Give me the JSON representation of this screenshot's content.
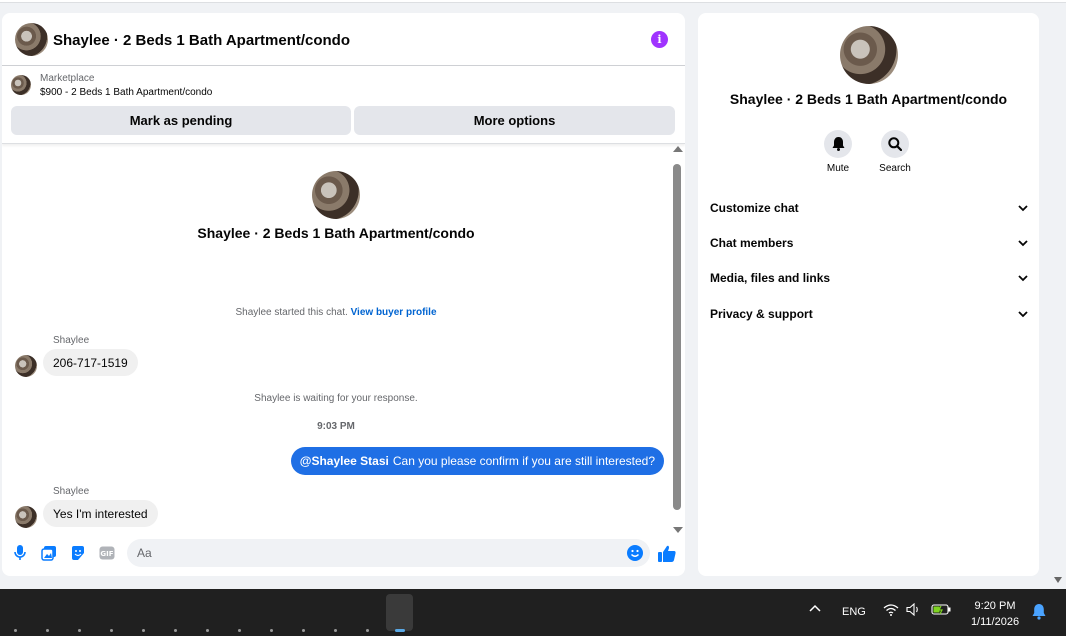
{
  "chat": {
    "title": "Shaylee · 2 Beds 1 Bath Apartment/condo",
    "info_icon": "info-icon",
    "marketplace_label": "Marketplace",
    "listing": "$900 - 2 Beds 1 Bath Apartment/condo",
    "mark_pending": "Mark as pending",
    "more_options": "More options",
    "intro_title": "Shaylee · 2 Beds 1 Bath Apartment/condo",
    "started_text": "Shaylee started this chat.",
    "view_buyer_profile": "View buyer profile",
    "messages": [
      {
        "sender": "Shaylee",
        "text": "206-717-1519"
      },
      {
        "sender": "Shaylee",
        "text": "Yes I'm interested"
      }
    ],
    "waiting_text": "Shaylee is waiting for your response.",
    "time": "9:03 PM",
    "outgoing": {
      "mention": "@Shaylee Stasi",
      "text": "Can you please confirm if you are still interested?"
    },
    "composer_placeholder": "Aa",
    "accent_color": "#0a7cff"
  },
  "info_panel": {
    "title": "Shaylee · 2 Beds 1 Bath Apartment/condo",
    "actions": [
      {
        "label": "Mute",
        "icon": "bell-icon"
      },
      {
        "label": "Search",
        "icon": "search-icon"
      }
    ],
    "sections": [
      "Customize chat",
      "Chat members",
      "Media, files and links",
      "Privacy & support"
    ]
  },
  "taskbar": {
    "language": "ENG",
    "time": "9:20 PM",
    "date": "1/11/2026"
  }
}
